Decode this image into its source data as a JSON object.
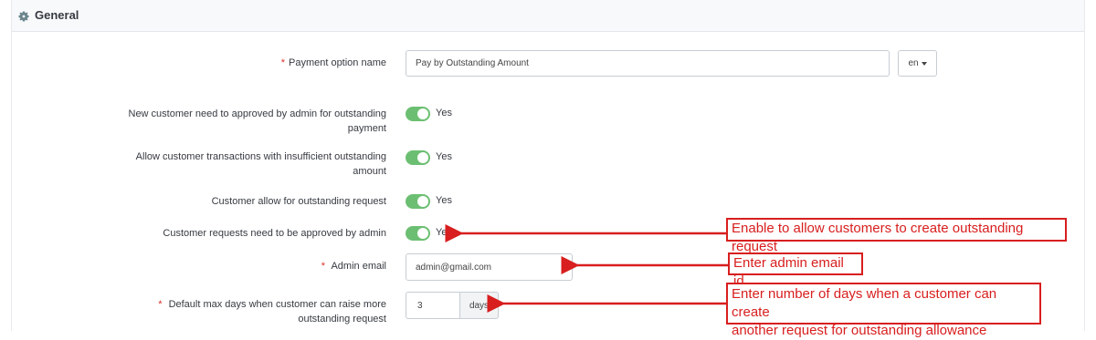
{
  "panel": {
    "title": "General",
    "icon": "gear-icon"
  },
  "payment_option": {
    "label": "Payment option name",
    "required_mark": "*",
    "value": "Pay by Outstanding Amount",
    "language": "en"
  },
  "toggles": [
    {
      "label_line1": "New customer need to approved by admin for outstanding",
      "label_line2": "payment",
      "state": "Yes"
    },
    {
      "label_line1": "Allow customer transactions with insufficient outstanding",
      "label_line2": "amount",
      "state": "Yes"
    },
    {
      "label_line1": "Customer allow for outstanding request",
      "label_line2": "",
      "state": "Yes"
    },
    {
      "label_line1": "Customer requests need to be approved by admin",
      "label_line2": "",
      "state": "Yes"
    }
  ],
  "admin_email": {
    "label": "Admin email",
    "required_mark": "*",
    "value": "admin@gmail.com"
  },
  "max_days": {
    "label_line1": "Default max days when customer can raise more",
    "label_line2": "outstanding request",
    "required_mark": "*",
    "value": "3",
    "unit": "days"
  },
  "annotations": {
    "toggle_note": "Enable to allow customers to create outstanding request",
    "email_note": "Enter admin email id",
    "days_note_line1": "Enter number of days when a customer can create",
    "days_note_line2": "another request for outstanding allowance",
    "color": "#d81e1e"
  },
  "colors": {
    "toggle_on": "#6cbf72",
    "required": "#d9302c"
  }
}
